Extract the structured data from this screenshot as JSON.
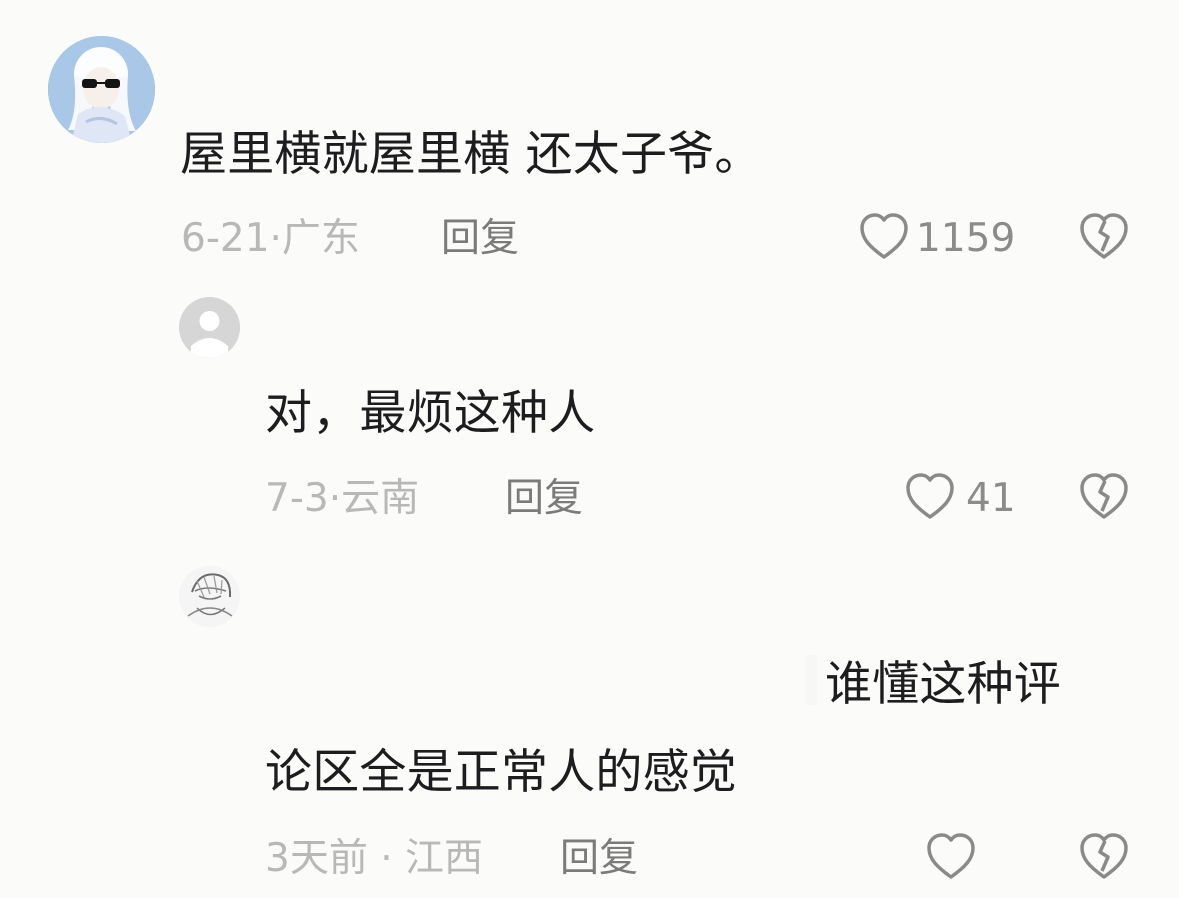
{
  "comments": [
    {
      "text": "屋里横就屋里横 还太子爷。",
      "date": "6-21",
      "location": "广东",
      "reply_label": "回复",
      "likes": "1159"
    },
    {
      "text": "对，最烦这种人",
      "date": "7-3",
      "location": "云南",
      "reply_label": "回复",
      "likes": "41"
    },
    {
      "text_line_1": "谁懂这种评",
      "text_line_2": "论区全是正常人的感觉",
      "date": "3天前",
      "location": "江西",
      "reply_label": "回复",
      "likes": ""
    }
  ],
  "icons": {
    "like": "heart-outline-icon",
    "dislike": "broken-heart-icon",
    "default_avatar": "user-avatar-icon"
  },
  "colors": {
    "background": "#fbfbf9",
    "text": "#1d1d1f",
    "meta": "#b8b8b8",
    "reply": "#7b7b7b",
    "icon": "#8a8a8a"
  }
}
